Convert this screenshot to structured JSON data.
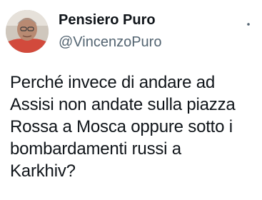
{
  "author": {
    "display_name": "Pensiero Puro",
    "handle": "@VincenzoPuro",
    "avatar_icon": "profile-photo"
  },
  "menu": {
    "icon": "more-options-icon"
  },
  "tweet": {
    "text": "Perché invece di andare ad\nAssisi non andate sulla piazza\nRossa a Mosca oppure sotto i\nbombardamenti russi a\nKarkhiv?"
  },
  "colors": {
    "text": "#0f1419",
    "secondary": "#536471",
    "background": "#ffffff"
  }
}
